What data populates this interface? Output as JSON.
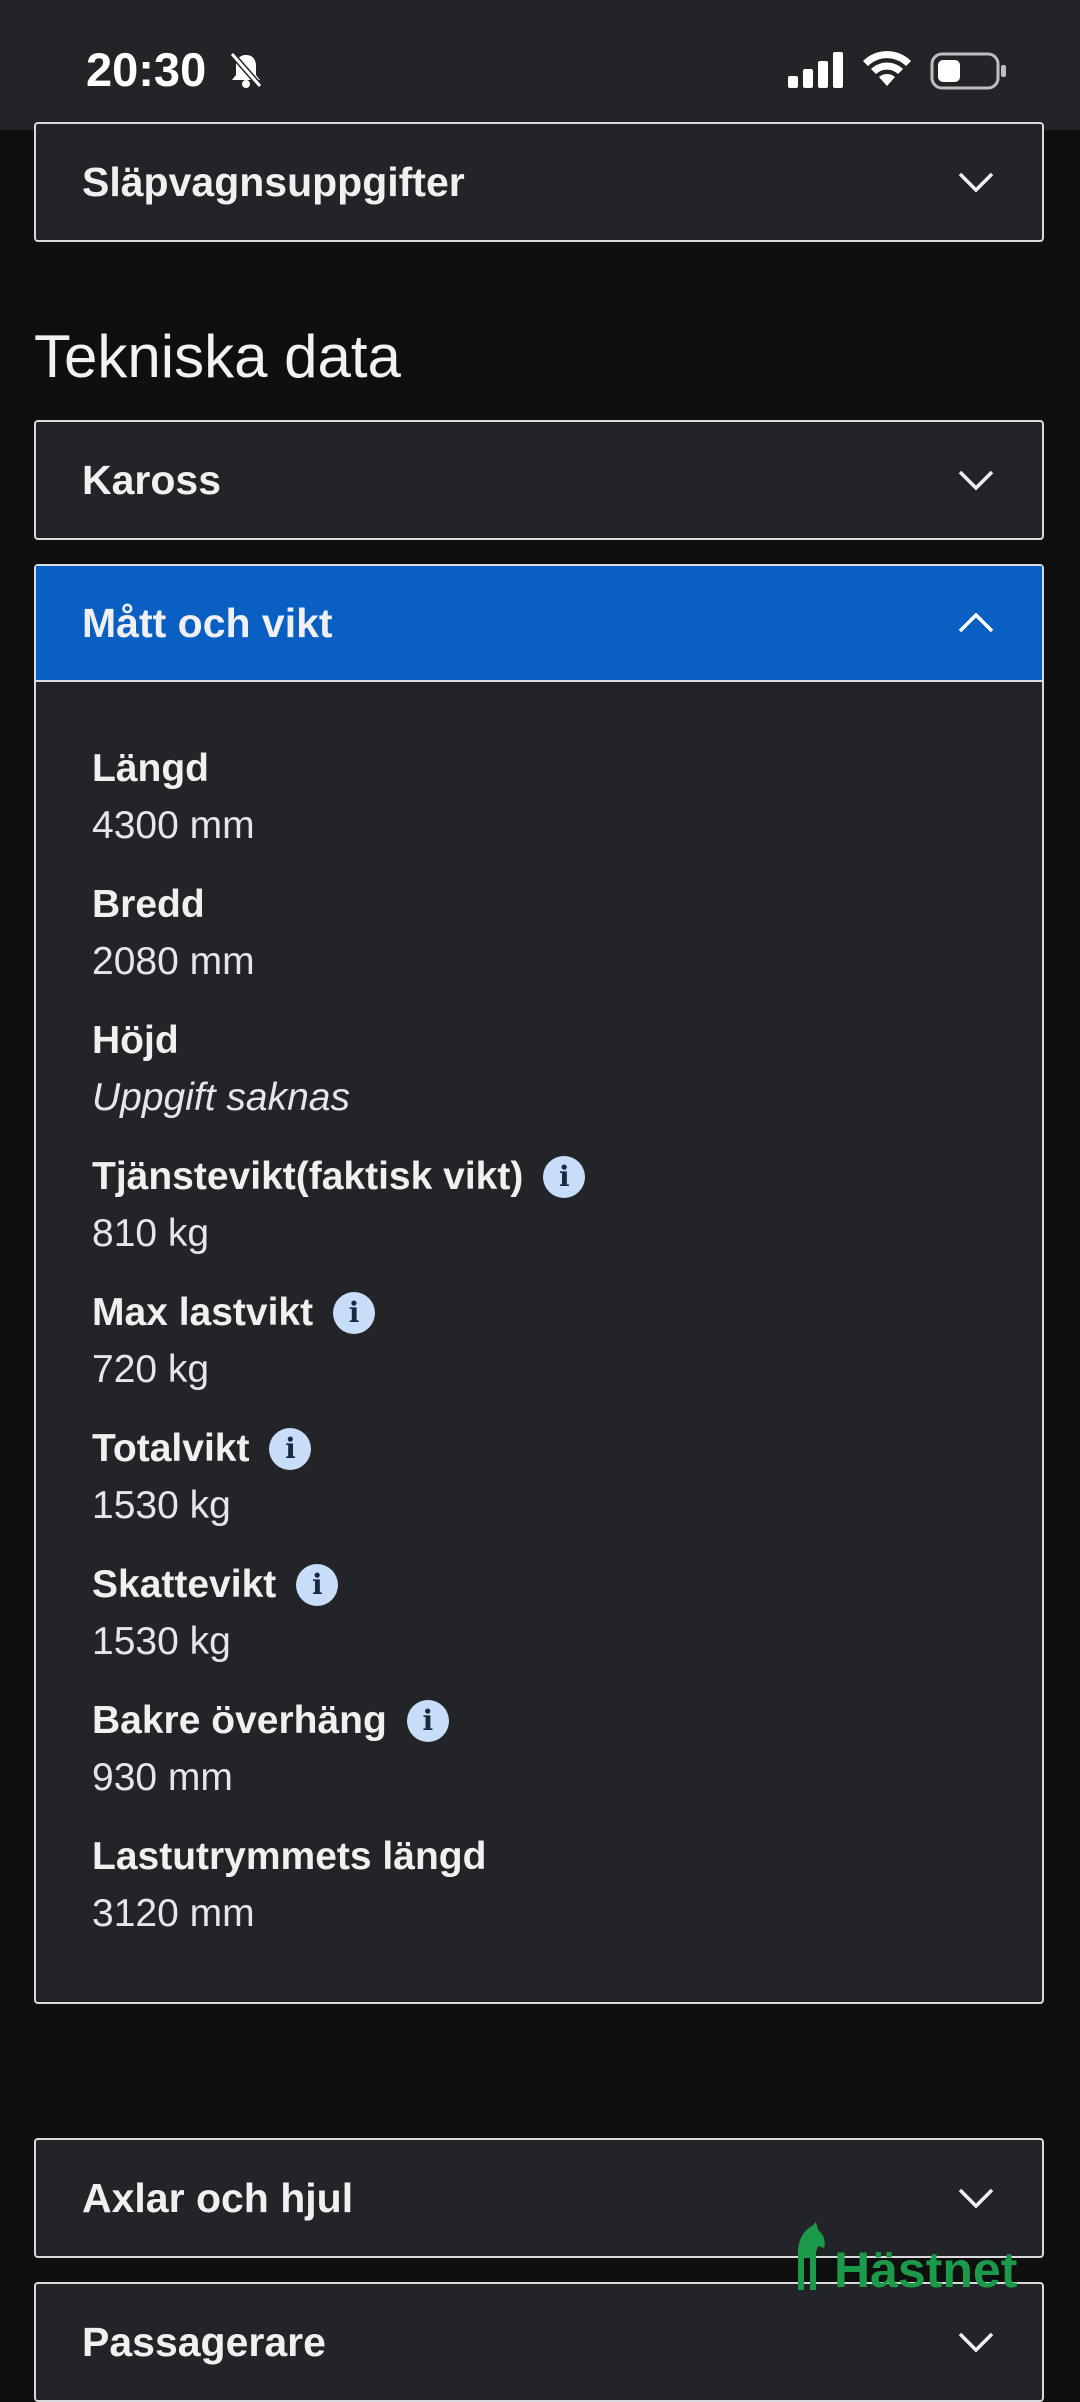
{
  "status_bar": {
    "time": "20:30",
    "icons": [
      "bell-muted-icon",
      "cellular-signal-icon",
      "wifi-icon",
      "battery-icon"
    ]
  },
  "top_accordion": {
    "label": "Släpvagnsuppgifter"
  },
  "section": {
    "title": "Tekniska data"
  },
  "kaross": {
    "label": "Kaross"
  },
  "matt_och_vikt": {
    "label": "Mått och vikt",
    "fields": [
      {
        "label": "Längd",
        "value": "4300 mm",
        "info": false
      },
      {
        "label": "Bredd",
        "value": "2080 mm",
        "info": false
      },
      {
        "label": "Höjd",
        "value": "Uppgift saknas",
        "info": false,
        "missing": true
      },
      {
        "label": "Tjänstevikt(faktisk vikt)",
        "value": "810 kg",
        "info": true
      },
      {
        "label": "Max lastvikt",
        "value": "720 kg",
        "info": true
      },
      {
        "label": "Totalvikt",
        "value": "1530 kg",
        "info": true
      },
      {
        "label": "Skattevikt",
        "value": "1530 kg",
        "info": true
      },
      {
        "label": "Bakre överhäng",
        "value": "930 mm",
        "info": true
      },
      {
        "label": "Lastutrymmets längd",
        "value": "3120 mm",
        "info": false
      }
    ]
  },
  "axlar": {
    "label": "Axlar och hjul"
  },
  "passagerare": {
    "label": "Passagerare"
  },
  "watermark": {
    "text": "Hästnet"
  },
  "colors": {
    "background": "#0f0f10",
    "panel": "#232428",
    "accent_blue": "#0a5fc2",
    "info_icon": "#c8def8",
    "watermark_green": "#1b9a4a"
  }
}
